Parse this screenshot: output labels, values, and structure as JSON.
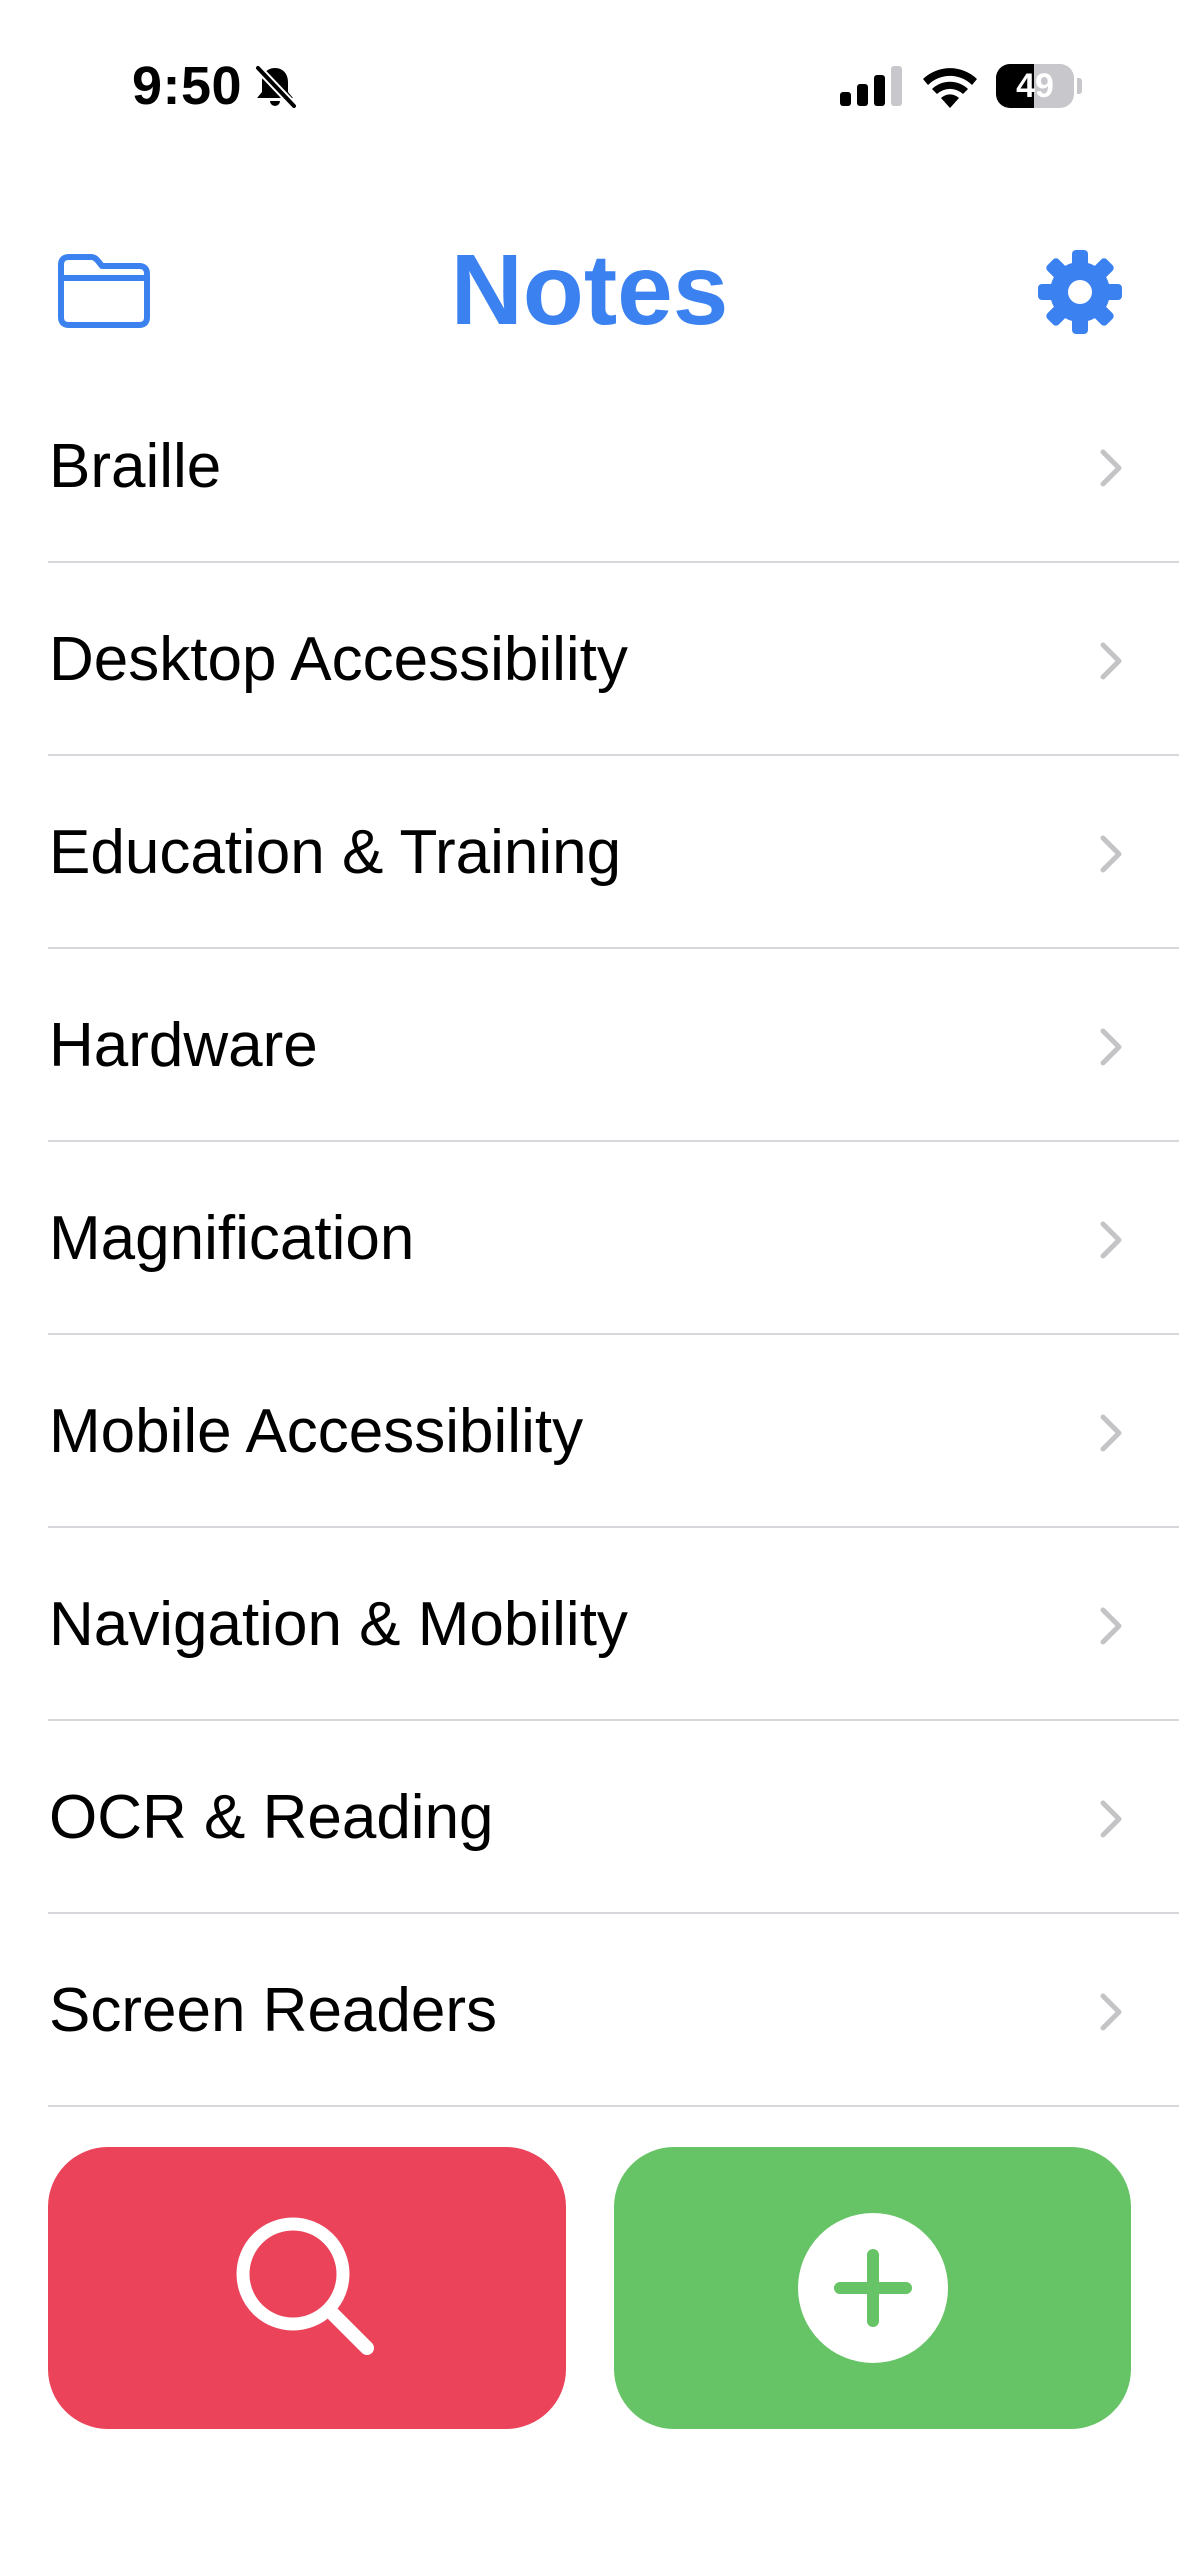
{
  "status_bar": {
    "time": "9:50",
    "battery_level": "49",
    "battery_fraction": 0.49,
    "icons": [
      "bell-slash-icon",
      "cellular-signal-icon",
      "wifi-icon",
      "battery-icon"
    ]
  },
  "header": {
    "title": "Notes",
    "left_icon": "folder-icon",
    "right_icon": "gear-icon"
  },
  "notes_list": {
    "items": [
      {
        "label": "Braille"
      },
      {
        "label": "Desktop Accessibility"
      },
      {
        "label": "Education & Training"
      },
      {
        "label": "Hardware"
      },
      {
        "label": "Magnification"
      },
      {
        "label": "Mobile Accessibility"
      },
      {
        "label": "Navigation & Mobility"
      },
      {
        "label": "OCR & Reading"
      },
      {
        "label": "Screen Readers"
      }
    ],
    "row_icon": "chevron-right-icon"
  },
  "actions": {
    "search_icon": "magnifying-glass-icon",
    "add_icon": "plus-circle-icon"
  },
  "colors": {
    "accent_blue": "#3b82f0",
    "search_red": "#ea435a",
    "add_green": "#67c466",
    "chevron_gray": "#c4c4c7",
    "divider_gray": "#d8d8dc"
  }
}
